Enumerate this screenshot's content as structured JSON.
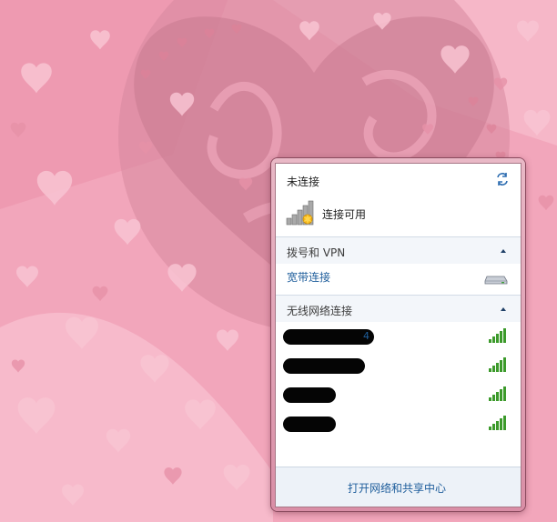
{
  "flyout": {
    "status_title": "未连接",
    "status_available": "连接可用",
    "dialup_section": {
      "label": "拨号和 VPN",
      "items": [
        {
          "label": "宽带连接"
        }
      ]
    },
    "wireless_section": {
      "label": "无线网络连接",
      "networks": [
        {
          "tail": "4"
        },
        {
          "tail": ""
        },
        {
          "tail": ""
        },
        {
          "tail": ""
        }
      ]
    },
    "footer_link": "打开网络和共享中心"
  },
  "icons": {
    "refresh": "refresh-icon",
    "signal": "signal-bars-icon",
    "caret": "chevron-up-icon",
    "broadband": "network-drive-icon"
  },
  "colors": {
    "link": "#1f5e9c",
    "wallpaper": "#f2a6bb",
    "signal_green": "#3c9a2b"
  }
}
